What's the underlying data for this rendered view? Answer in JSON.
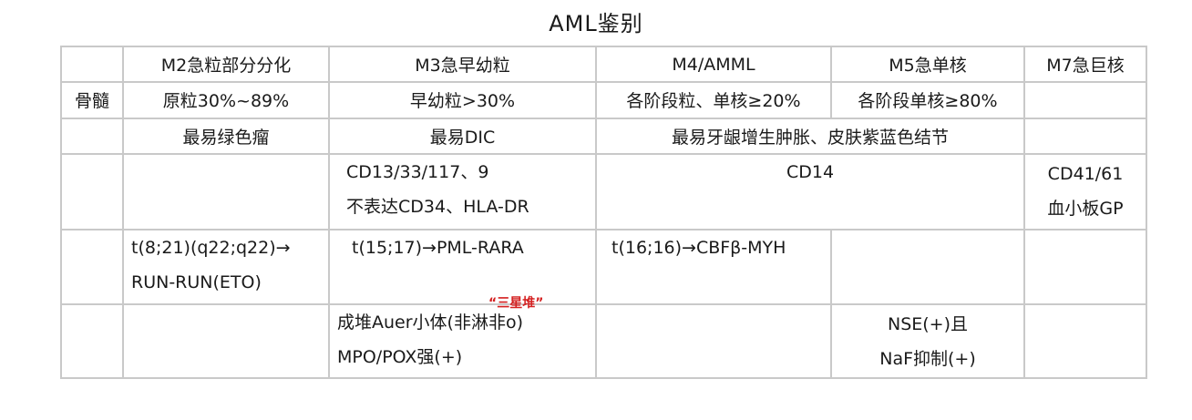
{
  "title": "AML鉴别",
  "header": {
    "m2": "M2急粒部分分化",
    "m3": "M3急早幼粒",
    "m4": "M4/AMML",
    "m5": "M5急单核",
    "m7": "M7急巨核"
  },
  "bone_marrow": {
    "label": "骨髓",
    "m2": "原粒30%~89%",
    "m3": "早幼粒>30%",
    "m4": "各阶段粒、单核≥20%",
    "m5": "各阶段单核≥80%"
  },
  "complication": {
    "m2": "最易绿色瘤",
    "m3": "最易DIC",
    "m4_m5": "最易牙龈增生肿胀、皮肤紫蓝色结节"
  },
  "immunophenotype": {
    "m3_line1": "CD13/33/117、9",
    "m3_line2": "不表达CD34、HLA-DR",
    "m4_m5": "CD14",
    "m7_line1": "CD41/61",
    "m7_line2": "血小板GP"
  },
  "genetics": {
    "m2_line1": "t(8;21)(q22;q22)→",
    "m2_line2": "RUN-RUN(ETO)",
    "m3": "t(15;17)→PML-RARA",
    "m4": "t(16;16)→CBFβ-MYH"
  },
  "annotation": "“三星堆”",
  "morphology": {
    "m3_line1": "成堆Auer小体(非淋非o)",
    "m3_line2": "MPO/POX强(+)",
    "m5_line1": "NSE(+)且",
    "m5_line2": "NaF抑制(+)"
  }
}
